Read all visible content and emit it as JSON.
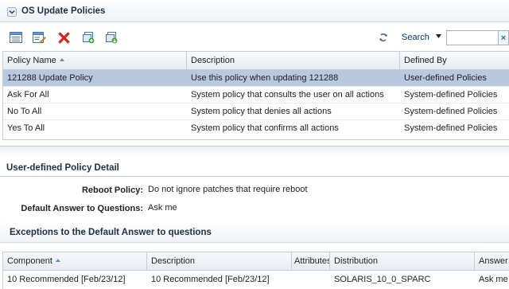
{
  "section1": {
    "title": "OS Update Policies"
  },
  "search": {
    "label": "Search",
    "placeholder": ""
  },
  "policies": {
    "columns": [
      "Policy Name",
      "Description",
      "Defined By"
    ],
    "rows": [
      [
        "121288 Update Policy",
        "Use this policy when updating 121288",
        "User-defined Policies"
      ],
      [
        "Ask For All",
        "System policy that consults the user on all actions",
        "System-defined Policies"
      ],
      [
        "No To All",
        "System policy that denies all actions",
        "System-defined Policies"
      ],
      [
        "Yes To All",
        "System policy that confirms all actions",
        "System-defined Policies"
      ]
    ]
  },
  "detail": {
    "title": "User-defined Policy Detail",
    "reboot_label": "Reboot Policy:",
    "reboot_value": "Do not ignore patches that require reboot",
    "default_label": "Default Answer to Questions:",
    "default_value": "Ask me"
  },
  "exceptions": {
    "title": "Exceptions to the Default Answer to questions",
    "columns": [
      "Component",
      "Description",
      "Attributes",
      "Distribution",
      "Answer"
    ],
    "rows": [
      [
        "10 Recommended [Feb/23/12]",
        "10 Recommended [Feb/23/12]",
        "",
        "SOLARIS_10_0_SPARC",
        "Ask me"
      ]
    ]
  },
  "colors": {
    "selected_row": "#b7c8df",
    "header_text": "#1e2f44",
    "link": "#0a3a6b",
    "delete": "#d8231b"
  }
}
